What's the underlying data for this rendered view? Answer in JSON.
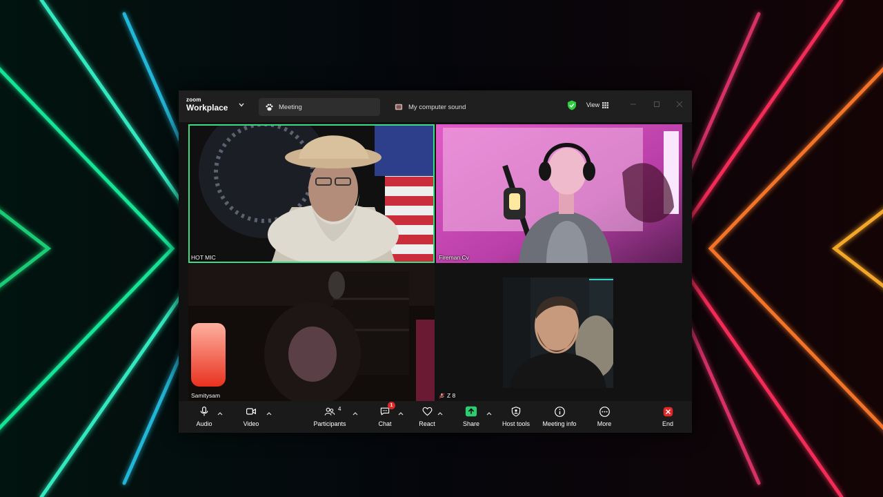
{
  "titlebar": {
    "brand_small": "zoom",
    "brand_big": "Workplace",
    "tabs": [
      {
        "label": "Meeting",
        "icon": "paw-icon"
      },
      {
        "label": "My computer sound",
        "icon": "speaker-icon"
      }
    ],
    "view_label": "View"
  },
  "participants": [
    {
      "name": "HOT MIC",
      "active_speaker": true
    },
    {
      "name": "Fireman Cv"
    },
    {
      "name": "Samitysam"
    },
    {
      "name": "Z 8",
      "muted": true
    }
  ],
  "toolbar": {
    "audio": "Audio",
    "video": "Video",
    "participants": "Participants",
    "participants_count": "4",
    "chat": "Chat",
    "chat_badge": "1",
    "react": "React",
    "share": "Share",
    "host_tools": "Host tools",
    "meeting_info": "Meeting info",
    "more": "More",
    "end": "End"
  },
  "colors": {
    "active_border": "#3ddc84",
    "share_green": "#2ecc71",
    "end_red": "#e02828",
    "secure_shield": "#2ecc40"
  }
}
